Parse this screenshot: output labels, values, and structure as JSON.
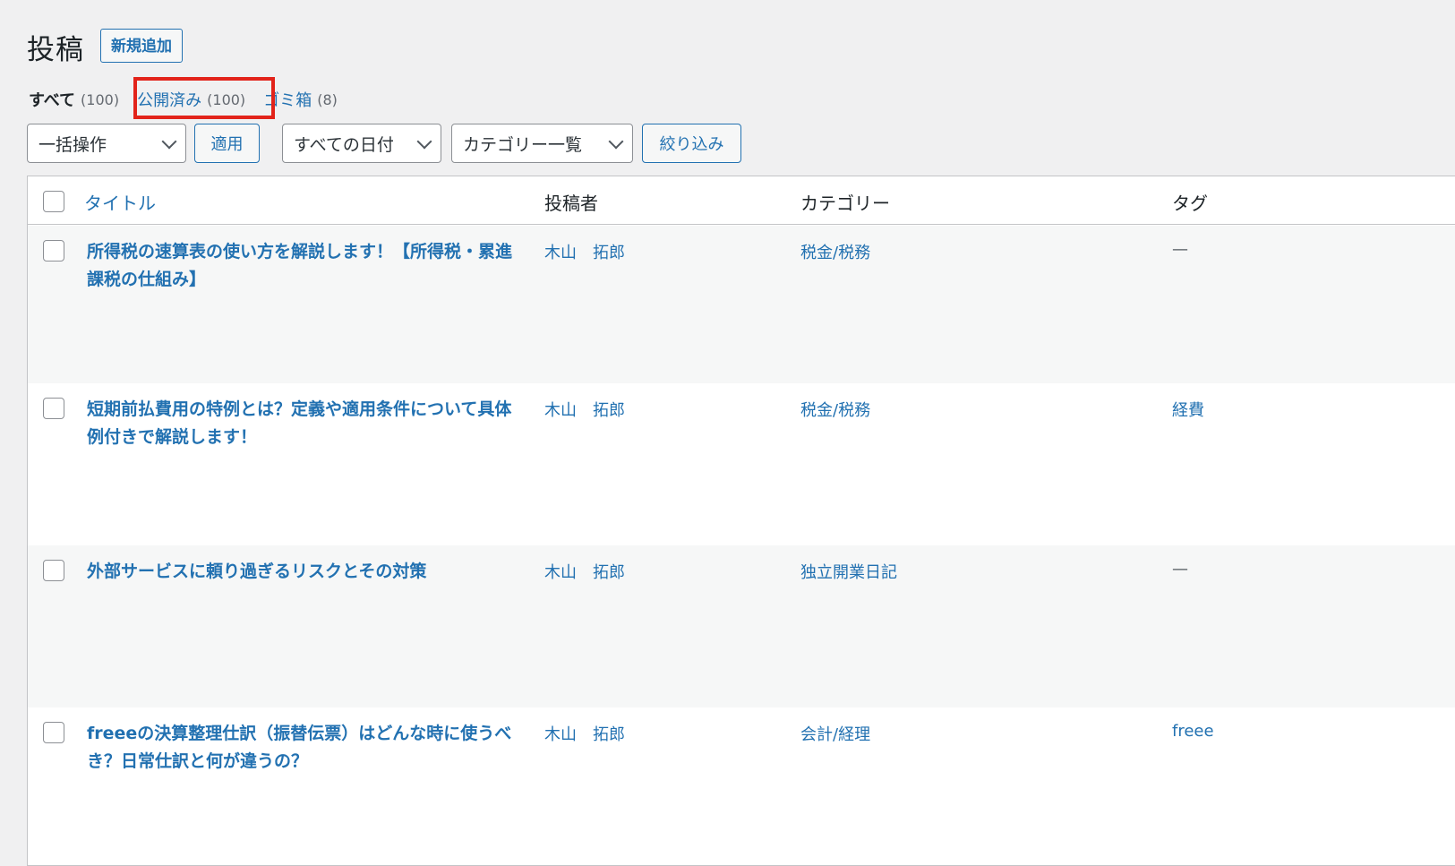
{
  "header": {
    "title": "投稿",
    "add_new_label": "新規追加"
  },
  "status_filter": {
    "all_label": "すべて",
    "all_count": "(100)",
    "published_label": "公開済み",
    "published_count": "(100)",
    "trash_label": "ゴミ箱",
    "trash_count": "(8)",
    "separator": "|"
  },
  "filters": {
    "bulk_action": "一括操作",
    "apply_label": "適用",
    "date_filter": "すべての日付",
    "category_filter": "カテゴリー一覧",
    "filter_label": "絞り込み"
  },
  "table": {
    "columns": {
      "title": "タイトル",
      "author": "投稿者",
      "categories": "カテゴリー",
      "tags": "タグ"
    },
    "rows": [
      {
        "title": "所得税の速算表の使い方を解説します！【所得税・累進課税の仕組み】",
        "author": "木山　拓郎",
        "category": "税金/税務",
        "tags": "—"
      },
      {
        "title": "短期前払費用の特例とは？定義や適用条件について具体例付きで解説します！",
        "author": "木山　拓郎",
        "category": "税金/税務",
        "tags": "経費"
      },
      {
        "title": "外部サービスに頼り過ぎるリスクとその対策",
        "author": "木山　拓郎",
        "category": "独立開業日記",
        "tags": "—"
      },
      {
        "title": "freeeの決算整理仕訳（振替伝票）はどんな時に使うべき？日常仕訳と何が違うの？",
        "author": "木山　拓郎",
        "category": "会計/経理",
        "tags": "freee"
      }
    ]
  },
  "colors": {
    "accent": "#2271b1",
    "highlight": "#e2231a",
    "background": "#f0f0f1"
  }
}
